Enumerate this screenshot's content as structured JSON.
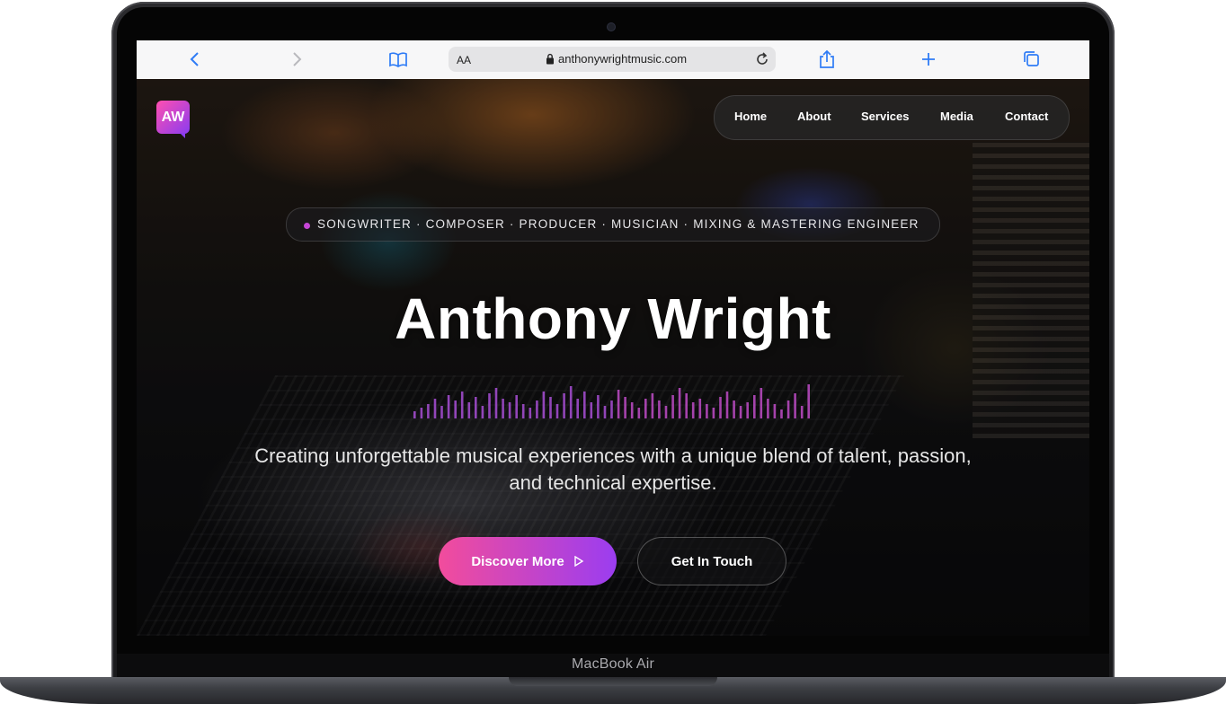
{
  "device": {
    "model": "MacBook Air"
  },
  "browser": {
    "text_size_label": "AA",
    "url": "anthonywrightmusic.com",
    "icons": [
      "back-icon",
      "forward-icon",
      "bookmarks-icon",
      "lock-icon",
      "reload-icon",
      "share-icon",
      "new-tab-icon",
      "tabs-icon"
    ]
  },
  "site": {
    "logo": "AW",
    "nav": [
      "Home",
      "About",
      "Services",
      "Media",
      "Contact"
    ],
    "roles": "SONGWRITER · COMPOSER · PRODUCER · MUSICIAN · MIXING & MASTERING ENGINEER",
    "title": "Anthony Wright",
    "tagline": "Creating unforgettable musical experiences with a unique blend of talent, passion, and technical expertise.",
    "primary_button": "Discover More",
    "secondary_button": "Get In Touch",
    "accent_colors": {
      "pink": "#f24c9c",
      "purple": "#9b3df0"
    }
  }
}
